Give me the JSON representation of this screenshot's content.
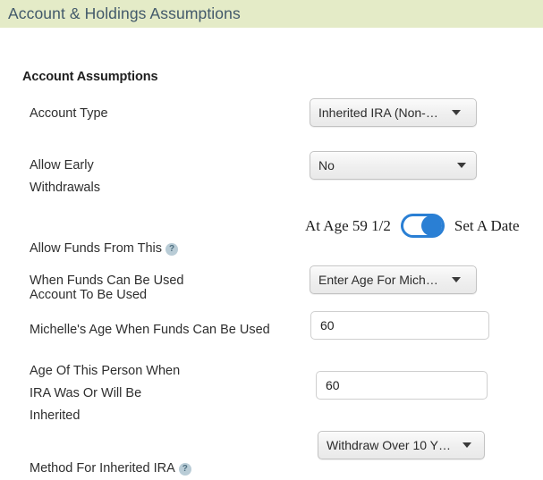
{
  "panel": {
    "header_title": "Account & Holdings Assumptions",
    "section_title": "Account Assumptions",
    "header_bg": "#e4ebc7",
    "header_text_color": "#42596a",
    "accent_color": "#2a7fd4",
    "help_icon_color": "#b9ccd6"
  },
  "rows": {
    "account_type": {
      "label": "Account Type",
      "value": "Inherited IRA (Non-…",
      "control": "dropdown"
    },
    "allow_early_withdrawals": {
      "label": "Allow Early\nWithdrawals",
      "value": "No",
      "control": "dropdown"
    },
    "allow_funds_from_account": {
      "label_line1": "Allow Funds From This",
      "label_line2": "Account To Be Used",
      "help_icon": "question-mark-icon",
      "help_glyph": "?",
      "toggle_left_label": "At Age 59 1/2",
      "toggle_right_label": "Set A Date",
      "toggle_state": "right",
      "control": "toggle"
    },
    "when_funds_can_be_used": {
      "label": "When Funds Can Be Used",
      "value": "Enter Age For Mich…",
      "control": "dropdown"
    },
    "michelles_age": {
      "label": "Michelle's Age When Funds Can Be Used",
      "value": "60",
      "control": "text-input"
    },
    "age_of_this_person": {
      "label": "Age Of This Person When\nIRA Was Or Will Be\nInherited",
      "value": "60",
      "control": "text-input"
    },
    "method_for_inherited_ira": {
      "label": "Method For Inherited IRA",
      "help_icon": "question-mark-icon",
      "help_glyph": "?",
      "value": "Withdraw Over 10 Y…",
      "control": "dropdown"
    }
  }
}
